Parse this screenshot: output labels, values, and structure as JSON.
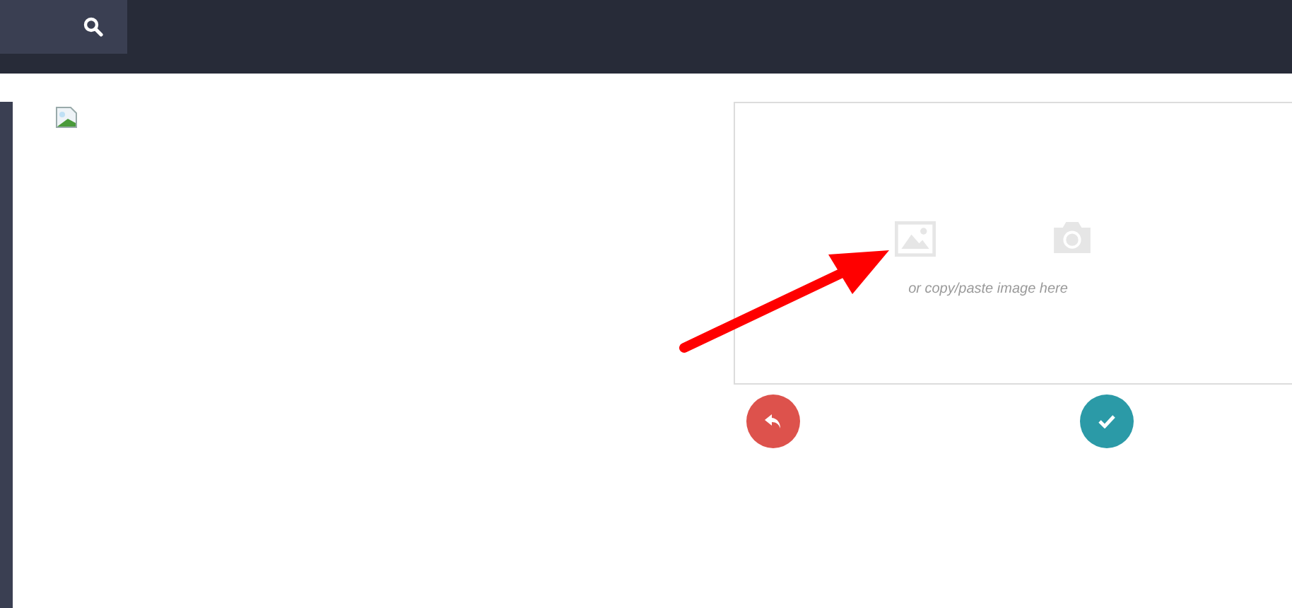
{
  "dropzone": {
    "hint": "or copy/paste image here"
  }
}
